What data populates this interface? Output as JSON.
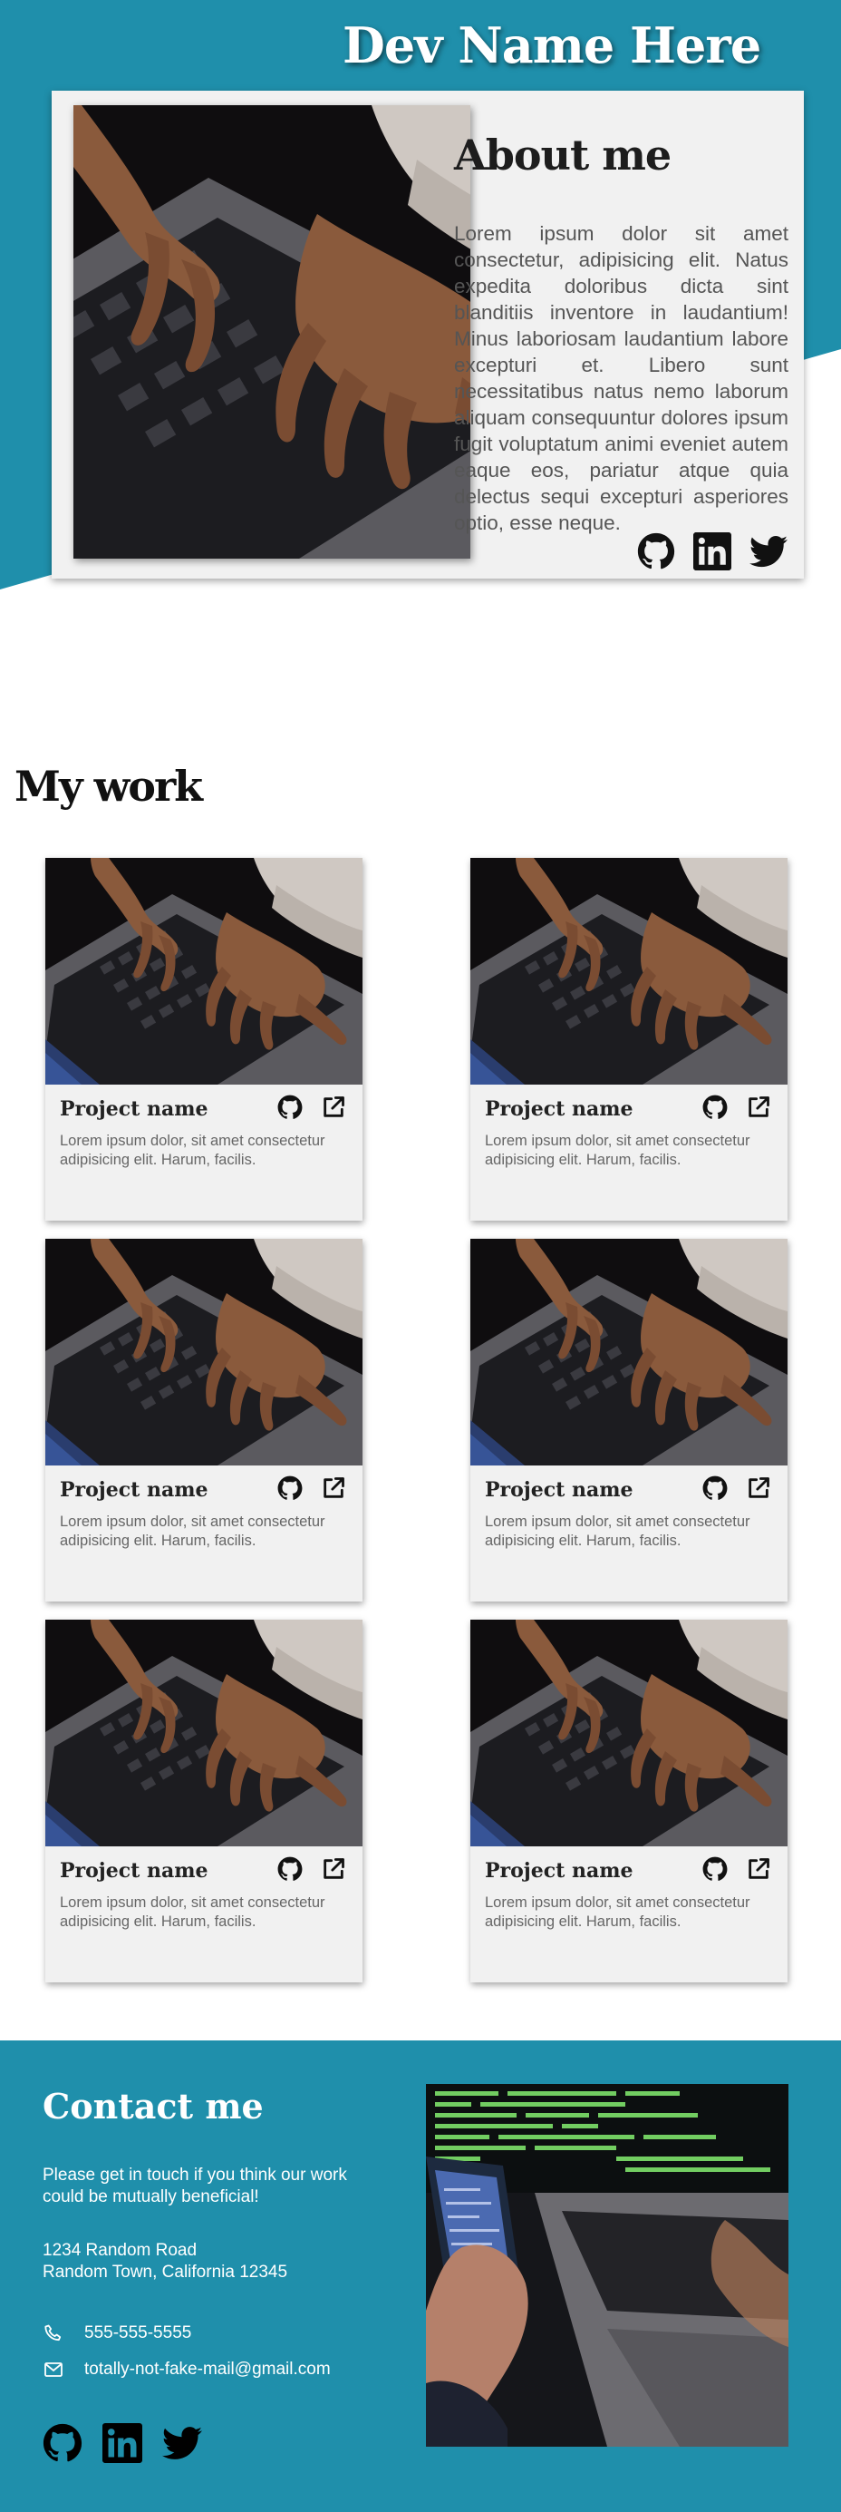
{
  "header": {
    "dev_name": "Dev Name Here"
  },
  "about": {
    "title": "About me",
    "text": "Lorem ipsum dolor sit amet consectetur, adipisicing elit. Natus expedita doloribus dicta sint blanditiis inventore in laudantium! Minus laboriosam laudantium labore excepturi et. Libero sunt necessitatibus natus nemo laborum aliquam consequuntur dolores ipsum fugit voluptatum animi eveniet autem eaque eos, pariatur atque quia delectus sequi excepturi asperiores optio, esse neque.",
    "social_icons": [
      "github-icon",
      "linkedin-icon",
      "twitter-icon"
    ]
  },
  "work": {
    "title": "My work",
    "projects": [
      {
        "name": "Project name",
        "description": "Lorem ipsum dolor, sit amet consectetur adipisicing elit. Harum, facilis."
      },
      {
        "name": "Project name",
        "description": "Lorem ipsum dolor, sit amet consectetur adipisicing elit. Harum, facilis."
      },
      {
        "name": "Project name",
        "description": "Lorem ipsum dolor, sit amet consectetur adipisicing elit. Harum, facilis."
      },
      {
        "name": "Project name",
        "description": "Lorem ipsum dolor, sit amet consectetur adipisicing elit. Harum, facilis."
      },
      {
        "name": "Project name",
        "description": "Lorem ipsum dolor, sit amet consectetur adipisicing elit. Harum, facilis."
      },
      {
        "name": "Project name",
        "description": "Lorem ipsum dolor, sit amet consectetur adipisicing elit. Harum, facilis."
      }
    ]
  },
  "contact": {
    "title": "Contact me",
    "intro": "Please get in touch if you think our work could be mutually beneficial!",
    "address_line1": "1234 Random Road",
    "address_line2": "Random Town, California 12345",
    "phone": "555-555-5555",
    "email": "totally-not-fake-mail@gmail.com",
    "social_icons": [
      "github-icon",
      "linkedin-icon",
      "twitter-icon"
    ]
  },
  "colors": {
    "accent": "#1f8fab",
    "card_bg": "#f1f1f1",
    "text_dark": "#1d1d1d",
    "text_muted": "#666666"
  }
}
